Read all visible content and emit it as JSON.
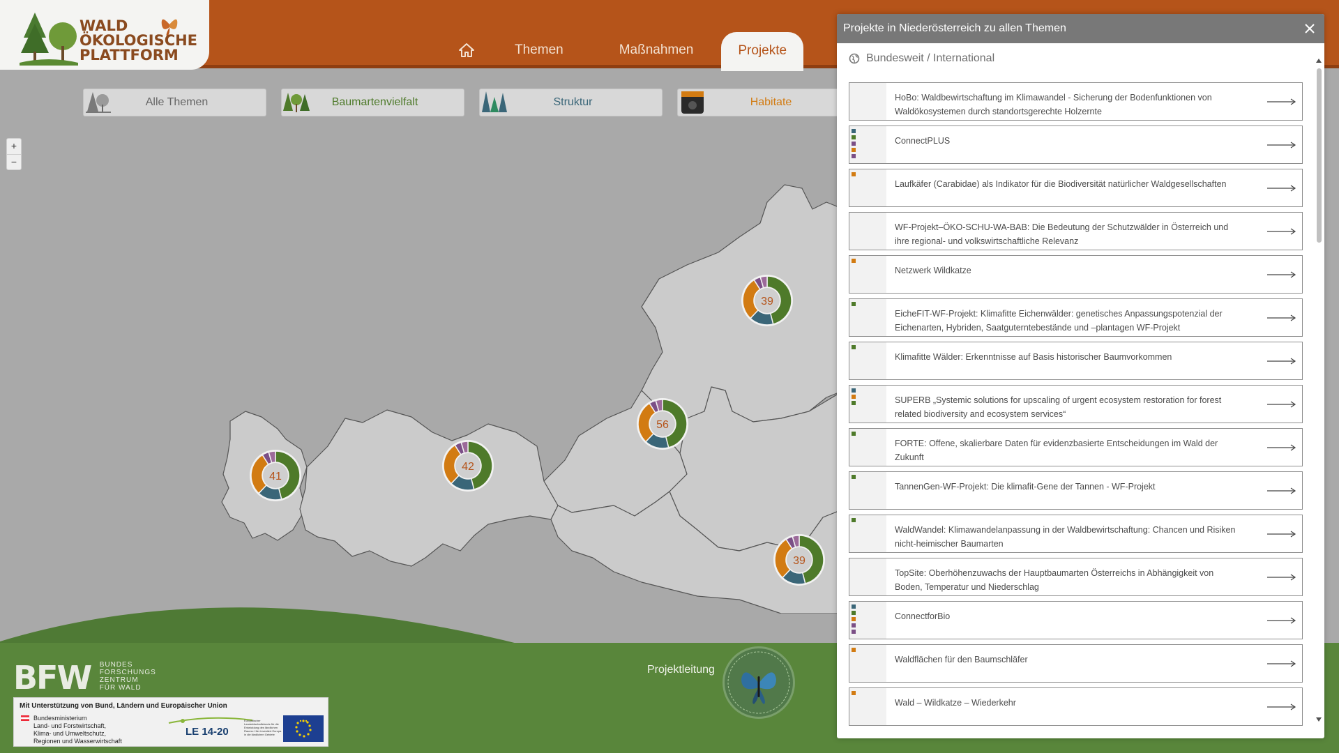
{
  "colors": {
    "brand_orange": "#b5541a",
    "forest_green": "#4e7a2a",
    "teal": "#3a6678",
    "habitat_orange": "#d27b12",
    "purple": "#7b4f86"
  },
  "header": {
    "logo": {
      "line1": "WALD",
      "line2": "ÖKOLOGISCHE",
      "line3": "PLATTFORM"
    },
    "nav": {
      "home_icon": "home-icon",
      "items": [
        {
          "label": "Themen",
          "active": false
        },
        {
          "label": "Maßnahmen",
          "active": false
        },
        {
          "label": "Projekte",
          "active": true
        }
      ]
    }
  },
  "filters": [
    {
      "label": "Alle Themen",
      "color": "#777777",
      "icon": "all-themes-icon"
    },
    {
      "label": "Baumartenvielfalt",
      "color": "#4e7a2a",
      "icon": "tree-species-icon"
    },
    {
      "label": "Struktur",
      "color": "#3a6678",
      "icon": "structure-icon"
    },
    {
      "label": "Habitate",
      "color": "#d27b12",
      "icon": "habitat-icon"
    }
  ],
  "map": {
    "zoom_in": "+",
    "zoom_out": "−",
    "clusters": [
      {
        "count": "41"
      },
      {
        "count": "42"
      },
      {
        "count": "56"
      },
      {
        "count": "39"
      },
      {
        "count": "39"
      }
    ]
  },
  "footer": {
    "bfw_logo": "BFW",
    "bfw_lines": [
      "BUNDES",
      "FORSCHUNGS",
      "ZENTRUM",
      "FÜR WALD"
    ],
    "support_title": "Mit Unterstützung von Bund, Ländern und Europäischer Union",
    "ministry_lines": [
      "Bundesministerium",
      "Land- und Forstwirtschaft,",
      "Klima- und Umweltschutz,",
      "Regionen und Wasserwirtschaft"
    ],
    "le_logo": "LE 14-20",
    "eu_text": "Europäischer Landwirtschaftsfonds für die Entwicklung des ländlichen Raums: Hier investiert Europa in die ländlichen Gebiete",
    "projektleitung": "Projektleitung"
  },
  "panel": {
    "title": "Projekte in Niederösterreich zu allen Themen",
    "close_icon": "close-icon",
    "section": "Bundesweit / International",
    "section_icon": "globe-icon",
    "projects": [
      {
        "title": "HoBo: Waldbewirtschaftung im Klimawandel - Sicherung der Bodenfunktionen von Waldökosystemen durch standortsgerechte Holzernte",
        "marks": []
      },
      {
        "title": "ConnectPLUS",
        "marks": [
          "#3a6678",
          "#4e7a2a",
          "#7b4f86",
          "#d27b12",
          "#7b4f86"
        ]
      },
      {
        "title": "Laufkäfer (Carabidae) als Indikator für die Biodiversität natürlicher Waldgesellschaften",
        "marks": [
          "#d27b12"
        ]
      },
      {
        "title": "WF-Projekt–ÖKO-SCHU-WA-BAB: Die Bedeutung der Schutzwälder in Österreich und ihre regional- und volkswirtschaftliche Relevanz",
        "marks": []
      },
      {
        "title": "Netzwerk Wildkatze",
        "marks": [
          "#d27b12"
        ]
      },
      {
        "title": "EicheFIT-WF-Projekt: Klimafitte Eichenwälder: genetisches Anpassungspotenzial der Eichenarten, Hybriden, Saatguterntebestände und –plantagen WF-Projekt",
        "marks": [
          "#4e7a2a"
        ]
      },
      {
        "title": "Klimafitte Wälder: Erkenntnisse auf Basis historischer Baumvorkommen",
        "marks": [
          "#4e7a2a"
        ]
      },
      {
        "title": "SUPERB „Systemic solutions for upscaling of urgent ecosystem restoration for forest related biodiversity and ecosystem services“",
        "marks": [
          "#3a6678",
          "#d27b12",
          "#4e7a2a"
        ]
      },
      {
        "title": "FORTE: Offene, skalierbare Daten für evidenzbasierte Entscheidungen im Wald der Zukunft",
        "marks": [
          "#4e7a2a"
        ]
      },
      {
        "title": "TannenGen-WF-Projekt: Die klimafit-Gene der Tannen - WF-Projekt",
        "marks": [
          "#4e7a2a"
        ]
      },
      {
        "title": "WaldWandel: Klimawandelanpassung in der Waldbewirtschaftung: Chancen und Risiken nicht-heimischer Baumarten",
        "marks": [
          "#4e7a2a"
        ]
      },
      {
        "title": "TopSite: Oberhöhenzuwachs der Hauptbaumarten Österreichs in Abhängigkeit von Boden, Temperatur und Niederschlag",
        "marks": []
      },
      {
        "title": "ConnectforBio",
        "marks": [
          "#3a6678",
          "#4e7a2a",
          "#d27b12",
          "#7b4f86",
          "#7b4f86"
        ]
      },
      {
        "title": "Waldflächen für den Baumschläfer",
        "marks": [
          "#d27b12"
        ]
      },
      {
        "title": "Wald – Wildkatze – Wiederkehr",
        "marks": [
          "#d27b12"
        ]
      }
    ]
  }
}
